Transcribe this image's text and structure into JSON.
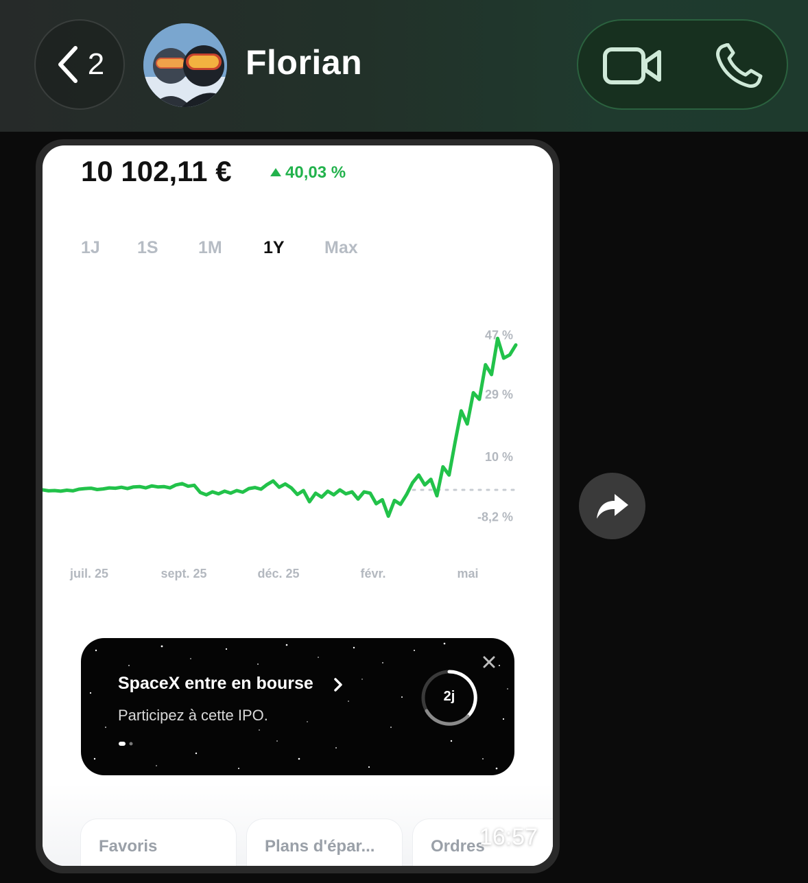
{
  "header": {
    "unread_count": "2",
    "contact_name": "Florian",
    "colors": {
      "accent_green": "#1e3a2d",
      "pill_border": "#3c8c5a"
    }
  },
  "message": {
    "timestamp": "16:57",
    "screenshot": {
      "balance": "10 102,11 €",
      "change": "40,03 %",
      "ranges": [
        {
          "label": "1J",
          "active": false
        },
        {
          "label": "1S",
          "active": false
        },
        {
          "label": "1M",
          "active": false
        },
        {
          "label": "1Y",
          "active": true
        },
        {
          "label": "Max",
          "active": false
        }
      ],
      "promo": {
        "title": "SpaceX entre en bourse",
        "subtitle": "Participez à cette IPO.",
        "timer": "2j"
      },
      "cards": [
        {
          "label": "Favoris"
        },
        {
          "label": "Plans d'épar..."
        },
        {
          "label": "Ordres"
        }
      ]
    }
  },
  "chart_data": {
    "type": "line",
    "title": "",
    "xlabel": "",
    "ylabel": "",
    "x_tick_labels": [
      "juil. 25",
      "sept. 25",
      "déc. 25",
      "févr.",
      "mai"
    ],
    "y_tick_labels": [
      "47 %",
      "29 %",
      "10 %",
      "-8,2 %"
    ],
    "y_ticks": [
      47,
      29,
      10,
      -8.2
    ],
    "ylim": [
      -10,
      50
    ],
    "baseline": 0,
    "grid": false,
    "line_color": "#22c24a",
    "series": [
      {
        "values": [
          0,
          -0.3,
          -0.2,
          -0.4,
          -0.1,
          -0.3,
          0.2,
          0.4,
          0.5,
          0.1,
          0.3,
          0.6,
          0.5,
          0.8,
          0.4,
          0.9,
          1.0,
          0.6,
          1.2,
          0.9,
          1.0,
          0.6,
          1.5,
          1.9,
          1.1,
          1.4,
          -0.8,
          -1.5,
          -0.6,
          -1.2,
          -0.4,
          -1.0,
          -0.2,
          -0.7,
          0.4,
          0.7,
          0.2,
          1.6,
          2.7,
          0.8,
          1.8,
          0.6,
          -1.4,
          -0.2,
          -3.6,
          -1.0,
          -2.2,
          -0.4,
          -1.5,
          0.0,
          -1.2,
          -0.6,
          -2.8,
          -0.6,
          -1.0,
          -4.2,
          -3.0,
          -8.0,
          -3.2,
          -4.4,
          -1.4,
          2.2,
          4.5,
          1.5,
          3.2,
          -1.8,
          7.0,
          4.5,
          14.5,
          24.0,
          20.0,
          29.5,
          27.5,
          38.0,
          35.0,
          46.0,
          40.0,
          41.0,
          44.0
        ]
      }
    ]
  }
}
